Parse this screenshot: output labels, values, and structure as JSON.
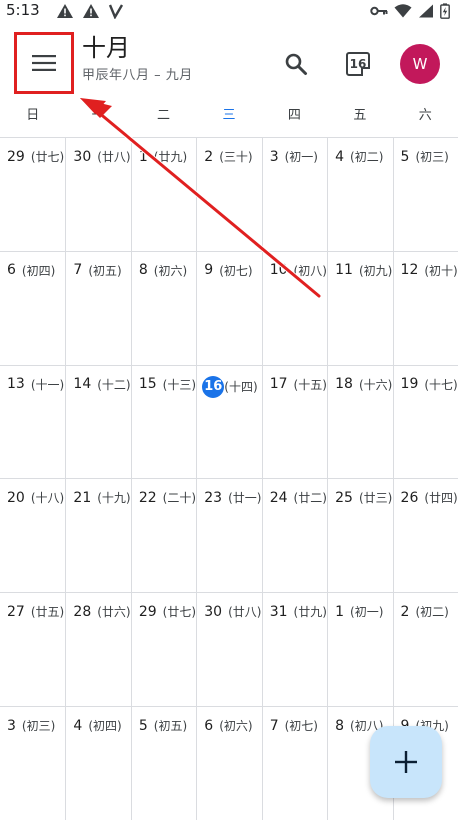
{
  "status_bar": {
    "time": "5:13"
  },
  "header": {
    "month_title": "十月",
    "lunar_subtitle": "甲辰年八月 – 九月",
    "today_icon_number": "16",
    "avatar_initial": "W"
  },
  "weekdays": [
    "日",
    "一",
    "二",
    "三",
    "四",
    "五",
    "六"
  ],
  "weeks": [
    [
      {
        "d": "29",
        "l": "(廿七)"
      },
      {
        "d": "30",
        "l": "(廿八)"
      },
      {
        "d": "1",
        "l": "(廿九)"
      },
      {
        "d": "2",
        "l": "(三十)"
      },
      {
        "d": "3",
        "l": "(初一)"
      },
      {
        "d": "4",
        "l": "(初二)"
      },
      {
        "d": "5",
        "l": "(初三)"
      }
    ],
    [
      {
        "d": "6",
        "l": "(初四)"
      },
      {
        "d": "7",
        "l": "(初五)"
      },
      {
        "d": "8",
        "l": "(初六)"
      },
      {
        "d": "9",
        "l": "(初七)"
      },
      {
        "d": "10",
        "l": "(初八)"
      },
      {
        "d": "11",
        "l": "(初九)"
      },
      {
        "d": "12",
        "l": "(初十)"
      }
    ],
    [
      {
        "d": "13",
        "l": "(十一)"
      },
      {
        "d": "14",
        "l": "(十二)"
      },
      {
        "d": "15",
        "l": "(十三)"
      },
      {
        "d": "16",
        "l": "(十四)",
        "today": true
      },
      {
        "d": "17",
        "l": "(十五)"
      },
      {
        "d": "18",
        "l": "(十六)"
      },
      {
        "d": "19",
        "l": "(十七)"
      }
    ],
    [
      {
        "d": "20",
        "l": "(十八)"
      },
      {
        "d": "21",
        "l": "(十九)"
      },
      {
        "d": "22",
        "l": "(二十)"
      },
      {
        "d": "23",
        "l": "(廿一)"
      },
      {
        "d": "24",
        "l": "(廿二)"
      },
      {
        "d": "25",
        "l": "(廿三)"
      },
      {
        "d": "26",
        "l": "(廿四)"
      }
    ],
    [
      {
        "d": "27",
        "l": "(廿五)"
      },
      {
        "d": "28",
        "l": "(廿六)"
      },
      {
        "d": "29",
        "l": "(廿七)"
      },
      {
        "d": "30",
        "l": "(廿八)"
      },
      {
        "d": "31",
        "l": "(廿九)"
      },
      {
        "d": "1",
        "l": "(初一)"
      },
      {
        "d": "2",
        "l": "(初二)"
      }
    ],
    [
      {
        "d": "3",
        "l": "(初三)"
      },
      {
        "d": "4",
        "l": "(初四)"
      },
      {
        "d": "5",
        "l": "(初五)"
      },
      {
        "d": "6",
        "l": "(初六)"
      },
      {
        "d": "7",
        "l": "(初七)"
      },
      {
        "d": "8",
        "l": "(初八)"
      },
      {
        "d": "9",
        "l": "(初九)"
      }
    ]
  ],
  "colors": {
    "accent": "#1a73e8",
    "avatar": "#c2185b",
    "fab": "#c8e5fb",
    "annotation": "#e02020"
  },
  "icons": {
    "menu": "menu-icon",
    "search": "search-icon",
    "today": "calendar-today-icon",
    "add": "add-icon"
  }
}
